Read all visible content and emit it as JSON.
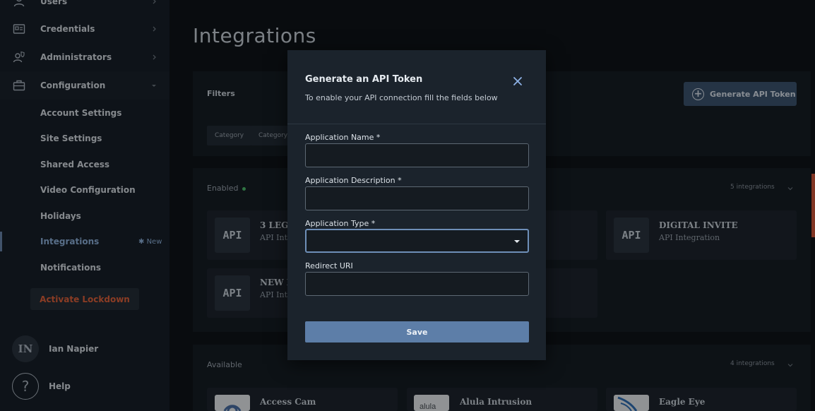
{
  "sidebar": {
    "nav": [
      {
        "label": "Users",
        "icon": "user-icon"
      },
      {
        "label": "Credentials",
        "icon": "id-card-icon"
      },
      {
        "label": "Administrators",
        "icon": "admin-user-icon"
      },
      {
        "label": "Configuration",
        "icon": "toolbox-icon"
      }
    ],
    "sub_items": [
      {
        "label": "Account Settings"
      },
      {
        "label": "Site Settings"
      },
      {
        "label": "Shared Access"
      },
      {
        "label": "Video Configuration"
      },
      {
        "label": "Holidays"
      },
      {
        "label": "Integrations",
        "badge": "New"
      },
      {
        "label": "Notifications"
      }
    ],
    "lockdown_label": "Activate Lockdown",
    "user": {
      "initials": "IN",
      "name": "Ian Napier"
    },
    "help": {
      "glyph": "?",
      "label": "Help"
    }
  },
  "main": {
    "title": "Integrations",
    "filters": {
      "label": "Filters",
      "chips": [
        "Category",
        "Category"
      ],
      "generate_button": "Generate API Token"
    },
    "enabled": {
      "label": "Enabled",
      "count": "5 integrations",
      "cards": [
        {
          "tile": "API",
          "title": "3 LEG",
          "subtitle": "API Inte"
        },
        {
          "tile": "API",
          "title": "DIGITAL INVITE",
          "subtitle": "API Integration"
        },
        {
          "tile": "API",
          "title": "NEW I",
          "subtitle": "API Inte"
        }
      ]
    },
    "available": {
      "label": "Available",
      "count": "4 integrations",
      "cards": [
        {
          "title": "Access Cam",
          "icon": "access-cam-logo"
        },
        {
          "title": "Alula Intrusion",
          "icon": "alula-logo",
          "logo_text": "alula"
        },
        {
          "title": "Eagle Eye",
          "icon": "eagle-eye-logo"
        }
      ]
    }
  },
  "modal": {
    "title": "Generate an API Token",
    "subtitle": "To enable your API connection fill the fields below",
    "fields": [
      {
        "label": "Application Name *",
        "value": ""
      },
      {
        "label": "Application Description *",
        "value": ""
      },
      {
        "label": "Application Type *",
        "value": ""
      },
      {
        "label": "Redirect URI",
        "value": ""
      }
    ],
    "save_label": "Save"
  },
  "colors": {
    "background": "#0f1419",
    "sidebar": "#182029",
    "accent_blue": "#5d7ea8",
    "lockdown_red": "#e0623a",
    "enabled_green": "#4dbb6c"
  }
}
